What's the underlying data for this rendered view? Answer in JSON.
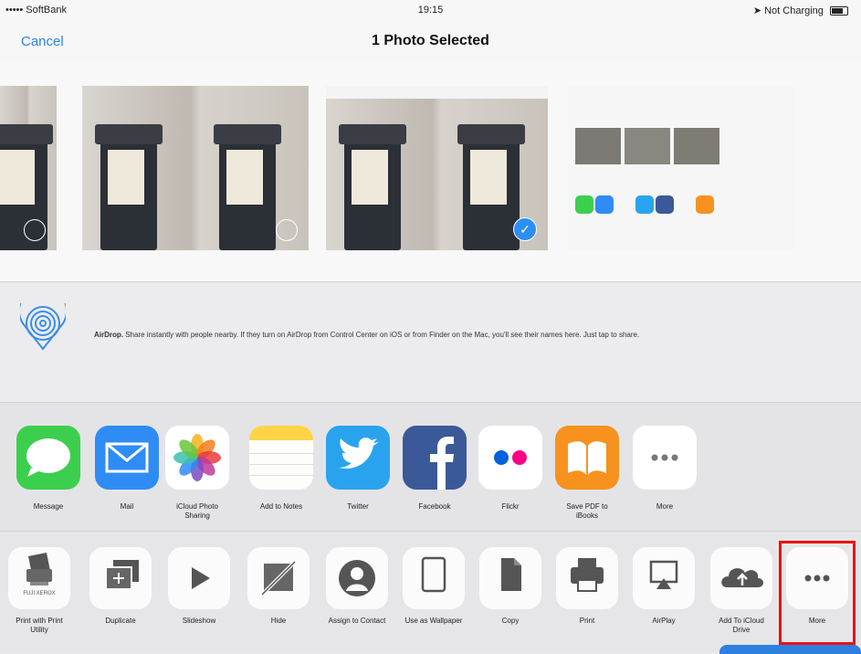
{
  "status": {
    "carrier": "••••• SoftBank",
    "time": "19:15",
    "battery": "Not Charging"
  },
  "nav": {
    "cancel": "Cancel",
    "title": "1 Photo Selected"
  },
  "airdrop": {
    "bold": "AirDrop.",
    "text": " Share instantly with people nearby. If they turn on AirDrop from Control Center on iOS or from Finder on the Mac, you'll see their names here. Just tap to share."
  },
  "apps": [
    {
      "label": "Message",
      "icon": "messages-icon",
      "color": "#3ccf4e"
    },
    {
      "label": "Mail",
      "icon": "mail-icon",
      "color": "#2f8cf5"
    },
    {
      "label": "iCloud Photo Sharing",
      "icon": "photos-icon",
      "color": "#ffffff"
    },
    {
      "label": "Add to Notes",
      "icon": "notes-icon",
      "color": "#fdd446"
    },
    {
      "label": "Twitter",
      "icon": "twitter-icon",
      "color": "#2aa3ef"
    },
    {
      "label": "Facebook",
      "icon": "facebook-icon",
      "color": "#3b5998"
    },
    {
      "label": "Flickr",
      "icon": "flickr-icon",
      "color": "#ffffff"
    },
    {
      "label": "Save PDF to iBooks",
      "icon": "ibooks-icon",
      "color": "#f7921e"
    },
    {
      "label": "More",
      "icon": "more-icon",
      "color": "#ffffff"
    }
  ],
  "actions": [
    {
      "label": "Print with Print Utility",
      "icon": "print-utility-icon",
      "brand": "FUJI XEROX"
    },
    {
      "label": "Duplicate",
      "icon": "duplicate-icon"
    },
    {
      "label": "Slideshow",
      "icon": "slideshow-icon"
    },
    {
      "label": "Hide",
      "icon": "hide-icon"
    },
    {
      "label": "Assign to Contact",
      "icon": "contact-icon"
    },
    {
      "label": "Use as Wallpaper",
      "icon": "wallpaper-icon"
    },
    {
      "label": "Copy",
      "icon": "copy-icon"
    },
    {
      "label": "Print",
      "icon": "print-icon"
    },
    {
      "label": "AirPlay",
      "icon": "airplay-icon"
    },
    {
      "label": "Add To iCloud Drive",
      "icon": "icloud-drive-icon"
    },
    {
      "label": "More",
      "icon": "more-icon"
    }
  ]
}
